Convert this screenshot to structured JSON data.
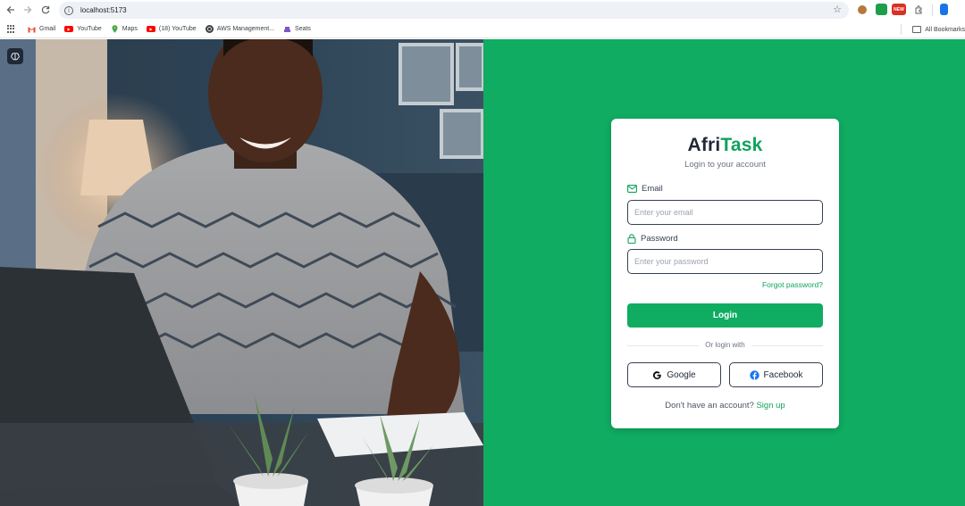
{
  "browser": {
    "url": "localhost:5173",
    "bookmarks": [
      {
        "label": "Gmail",
        "icon": "gmail-icon"
      },
      {
        "label": "YouTube",
        "icon": "youtube-icon"
      },
      {
        "label": "Maps",
        "icon": "maps-icon"
      },
      {
        "label": "(18) YouTube",
        "icon": "youtube-icon"
      },
      {
        "label": "AWS Management...",
        "icon": "aws-icon"
      },
      {
        "label": "Seats",
        "icon": "seats-icon"
      }
    ],
    "all_bookmarks_label": "All Bookmarks",
    "extension_badge": "NEW"
  },
  "login": {
    "brand_part1": "Afri",
    "brand_part2": "Task",
    "subtitle": "Login to your account",
    "email_label": "Email",
    "email_placeholder": "Enter your email",
    "password_label": "Password",
    "password_placeholder": "Enter your password",
    "forgot_label": "Forgot password?",
    "login_button": "Login",
    "divider_text": "Or login with",
    "google_label": "Google",
    "facebook_label": "Facebook",
    "signup_prompt": "Don't have an account?",
    "signup_link": "Sign up"
  },
  "colors": {
    "brand_green": "#10ac62",
    "brand_dark": "#1f2937"
  }
}
